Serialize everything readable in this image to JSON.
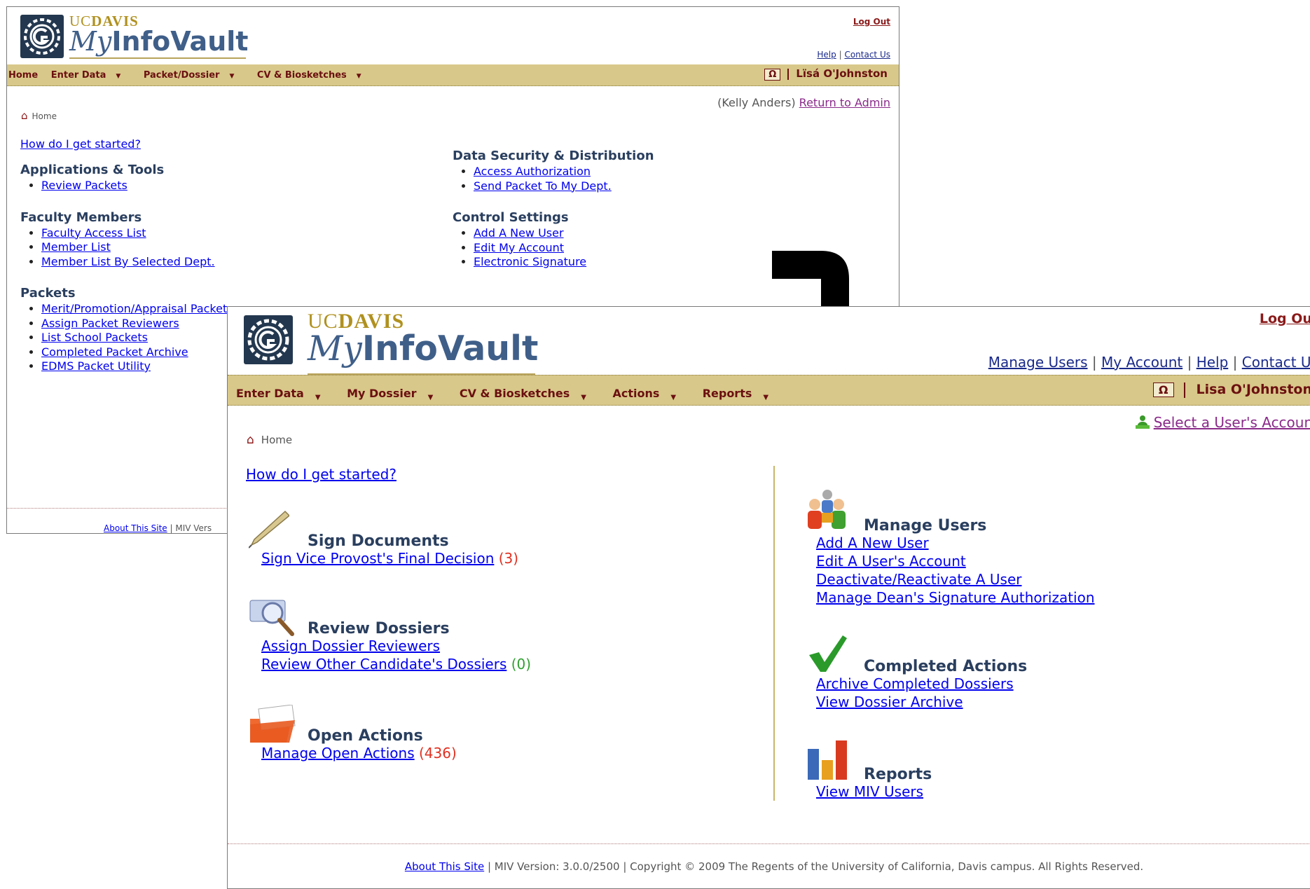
{
  "old_window": {
    "logo": {
      "ucdavis_uc": "UC",
      "ucdavis_davis": "DAVIS",
      "my": "My",
      "infovault": "InfoVault"
    },
    "logout": "Log Out",
    "help": "Help",
    "separator": "|",
    "contact": "Contact Us",
    "nav": {
      "home": "Home",
      "enter_data": "Enter Data",
      "packet_dossier": "Packet/Dossier",
      "cv": "CV & Biosketches",
      "dropdown_glyph": "▼"
    },
    "omega": "Ω",
    "user_name": "Lïsá O'Johnston",
    "admin_prefix": "(Kelly Anders)",
    "return_to_admin": "Return to Admin",
    "breadcrumb": "Home",
    "how_started": "How do I get started?",
    "sections": {
      "applications": {
        "title": "Applications & Tools",
        "items": [
          "Review Packets"
        ]
      },
      "faculty": {
        "title": "Faculty Members",
        "items": [
          "Faculty Access List",
          "Member List",
          "Member List By Selected Dept."
        ]
      },
      "packets": {
        "title": "Packets",
        "items": [
          "Merit/Promotion/Appraisal Packets",
          "Assign Packet Reviewers",
          "List School Packets",
          "Completed Packet Archive",
          "EDMS Packet Utility"
        ]
      },
      "security": {
        "title": "Data Security & Distribution",
        "items": [
          "Access Authorization",
          "Send Packet To My Dept."
        ]
      },
      "control": {
        "title": "Control Settings",
        "items": [
          "Add A New User",
          "Edit My Account",
          "Electronic Signature"
        ]
      }
    },
    "footer": {
      "about": "About This Site",
      "rest": "| MIV Vers"
    }
  },
  "new_window": {
    "logo": {
      "ucdavis_uc": "UC",
      "ucdavis_davis": "DAVIS",
      "my": "My",
      "infovault": "InfoVault"
    },
    "logout": "Log Out",
    "toplinks": {
      "manage_users": "Manage Users",
      "my_account": "My Account",
      "help": "Help",
      "contact": "Contact Us",
      "separator": "|"
    },
    "nav": {
      "enter_data": "Enter Data",
      "my_dossier": "My Dossier",
      "cv": "CV & Biosketches",
      "actions": "Actions",
      "reports": "Reports",
      "dropdown_glyph": "▼"
    },
    "omega": "Ω",
    "user_name": "Lisa O'Johnston",
    "select_account": "Select a User's Account",
    "breadcrumb": "Home",
    "how_started": "How do I get started?",
    "sign_documents": {
      "title": "Sign Documents",
      "link": "Sign Vice Provost's Final Decision",
      "count": "(3)"
    },
    "review_dossiers": {
      "title": "Review Dossiers",
      "link1": "Assign Dossier Reviewers",
      "link2": "Review Other Candidate's Dossiers",
      "count2": "(0)"
    },
    "open_actions": {
      "title": "Open Actions",
      "link": "Manage Open Actions",
      "count": "(436)"
    },
    "manage_users": {
      "title": "Manage Users",
      "links": [
        "Add A New User",
        "Edit A User's Account",
        "Deactivate/Reactivate A User",
        "Manage Dean's Signature Authorization"
      ]
    },
    "completed_actions": {
      "title": "Completed Actions",
      "links": [
        "Archive Completed Dossiers",
        "View Dossier Archive"
      ]
    },
    "reports": {
      "title": "Reports",
      "link": "View MIV Users"
    },
    "footer": {
      "about": "About This Site",
      "rest": "| MIV Version: 3.0.0/2500 | Copyright © 2009 The Regents of the University of California, Davis campus. All Rights Reserved."
    }
  },
  "colors": {
    "nav_bg": "#d8c88a",
    "brand_gold": "#b0911f",
    "brand_blue": "#3f5f89",
    "heading": "#2a3f5f",
    "maroon": "#6b1010",
    "link": "#0000ee",
    "count_red": "#e03020",
    "count_green": "#30a030"
  },
  "icons": [
    "gear-logo-icon",
    "home-icon",
    "person-icon",
    "pen-icon",
    "magnifier-icon",
    "folder-icon",
    "people-icon",
    "checkmark-icon",
    "bar-chart-icon",
    "curved-arrow-icon"
  ]
}
